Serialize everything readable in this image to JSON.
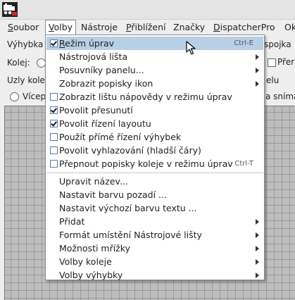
{
  "menubar": {
    "items": [
      {
        "label": "Soubor"
      },
      {
        "label": "Volby"
      },
      {
        "label": "Nástroje"
      },
      {
        "label": "Přiblížení"
      },
      {
        "label": "Značky"
      },
      {
        "label": "DispatcherPro"
      },
      {
        "label": "Ok"
      }
    ]
  },
  "toolbar": {
    "vyhybka_label": "Výhybka",
    "kolej_label": "Kolej:",
    "uzly_label": "Uzly kole",
    "vicep_label": "Vícep",
    "right_spojka": "spojka",
    "right_prer": "Přer",
    "right_elu": "elu",
    "right_snima": "a sníma"
  },
  "dropdown": {
    "section1": [
      {
        "label": "Režim úprav",
        "type": "checkbox",
        "checked": true,
        "accelerator": "Ctrl-E",
        "highlighted": true
      },
      {
        "label": "Nástrojová lišta",
        "type": "submenu"
      },
      {
        "label": "Posuvníky panelu...",
        "type": "submenu"
      },
      {
        "label": "Zobrazit popisky ikon",
        "type": "submenu"
      },
      {
        "label": "Zobrazit lištu nápovědy v režimu úprav",
        "type": "checkbox",
        "checked": false
      },
      {
        "label": "Povolit přesunutí",
        "type": "checkbox",
        "checked": true
      },
      {
        "label": "Povolit řízení layoutu",
        "type": "checkbox",
        "checked": true
      },
      {
        "label": "Použít přímé řízení výhybek",
        "type": "checkbox",
        "checked": false
      },
      {
        "label": "Povolit vyhlazování (hladší čáry)",
        "type": "checkbox",
        "checked": false
      },
      {
        "label": "Přepnout popisky koleje v režimu úprav",
        "type": "checkbox",
        "checked": false,
        "accelerator": "Ctrl-T"
      }
    ],
    "section2": [
      {
        "label": "Upravit název..."
      },
      {
        "label": "Nastavit barvu pozadí ..."
      },
      {
        "label": "Nastavit výchozí barvu textu ..."
      },
      {
        "label": "Přidat",
        "type": "submenu"
      },
      {
        "label": "Formát umístění Nástrojové lišty",
        "type": "submenu"
      },
      {
        "label": "Možnosti mřížky",
        "type": "submenu"
      },
      {
        "label": "Volby koleje",
        "type": "submenu"
      },
      {
        "label": "Volby výhybky",
        "type": "submenu"
      }
    ]
  },
  "colors": {
    "highlight": "#b8cfe5",
    "menu_bg": "#ffffff",
    "window_bg": "#eeeeee",
    "grid_bg": "#bdbdbd"
  }
}
